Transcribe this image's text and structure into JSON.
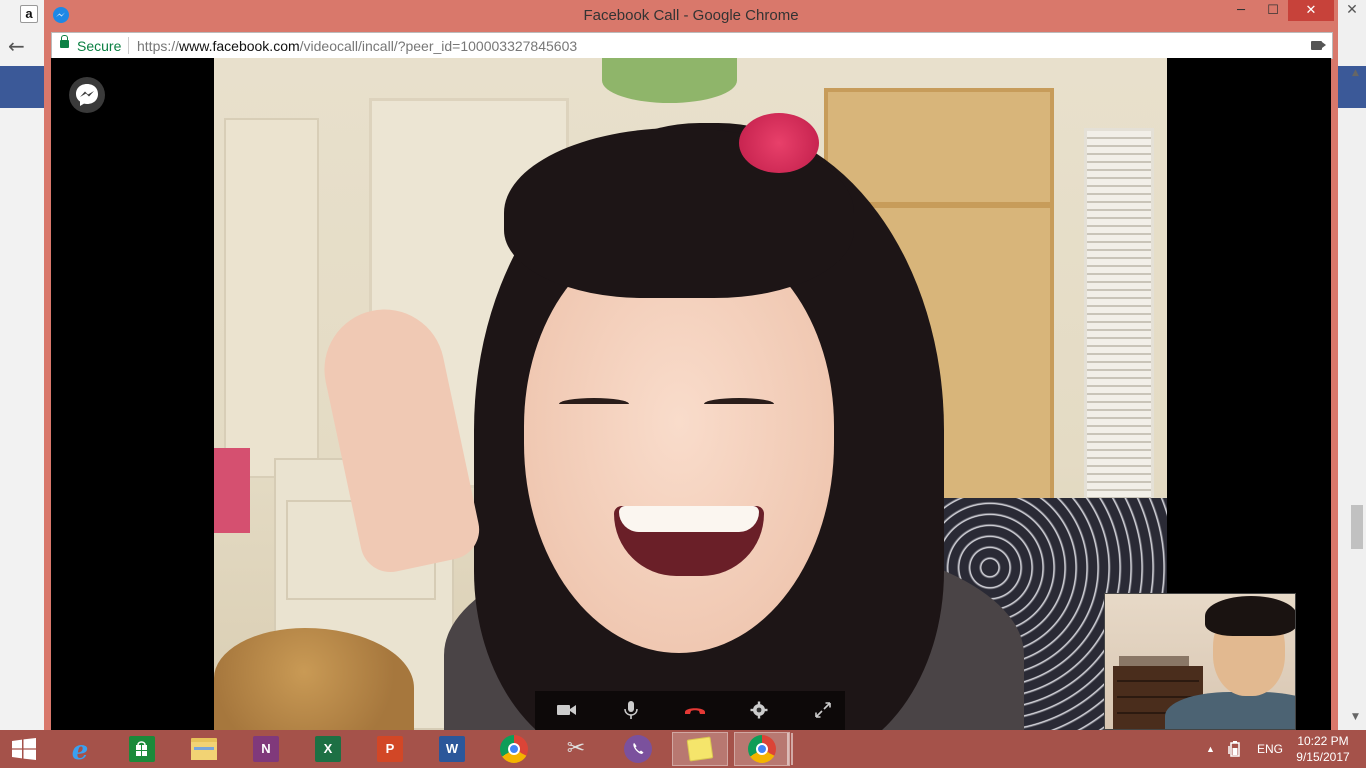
{
  "window": {
    "title": "Facebook Call - Google Chrome",
    "min_glyph": "─",
    "max_glyph": "☐",
    "close_glyph": "✕"
  },
  "background_window": {
    "amazon_glyph": "a",
    "back_glyph": "←",
    "right_close_glyph": "✕",
    "scroll_up_glyph": "▲",
    "scroll_down_glyph": "▼"
  },
  "addressbar": {
    "secure_label": "Secure",
    "url_scheme": "https://",
    "url_domain": "www.facebook.com",
    "url_path": "/videocall/incall/?peer_id=100003327845603"
  },
  "call": {
    "controls": [
      "video-icon",
      "microphone-icon",
      "end-call-icon",
      "settings-icon",
      "fullscreen-icon"
    ],
    "end_call_color": "#e53935"
  },
  "taskbar": {
    "items": [
      {
        "name": "internet-explorer",
        "glyph": "e",
        "color": "#1e88e5"
      },
      {
        "name": "windows-store",
        "glyph": "",
        "color": "#1b8a3a"
      },
      {
        "name": "file-explorer",
        "glyph": "",
        "color": "#e8c35a"
      },
      {
        "name": "onenote",
        "glyph": "N",
        "color": "#80397b"
      },
      {
        "name": "excel",
        "glyph": "X",
        "color": "#1d7044"
      },
      {
        "name": "powerpoint",
        "glyph": "P",
        "color": "#d24726"
      },
      {
        "name": "word",
        "glyph": "W",
        "color": "#2b579a"
      },
      {
        "name": "chrome",
        "glyph": "",
        "color": "#db4437"
      },
      {
        "name": "snipping-tool",
        "glyph": "✂",
        "color": "#d9d9d9"
      },
      {
        "name": "viber",
        "glyph": "",
        "color": "#7b519d"
      },
      {
        "name": "sticky-notes",
        "glyph": "",
        "color": "#f5e56b"
      },
      {
        "name": "chrome-active",
        "glyph": "",
        "color": "#db4437"
      }
    ],
    "tray_arrow": "▲",
    "language": "ENG",
    "time": "10:22 PM",
    "date": "9/15/2017"
  }
}
